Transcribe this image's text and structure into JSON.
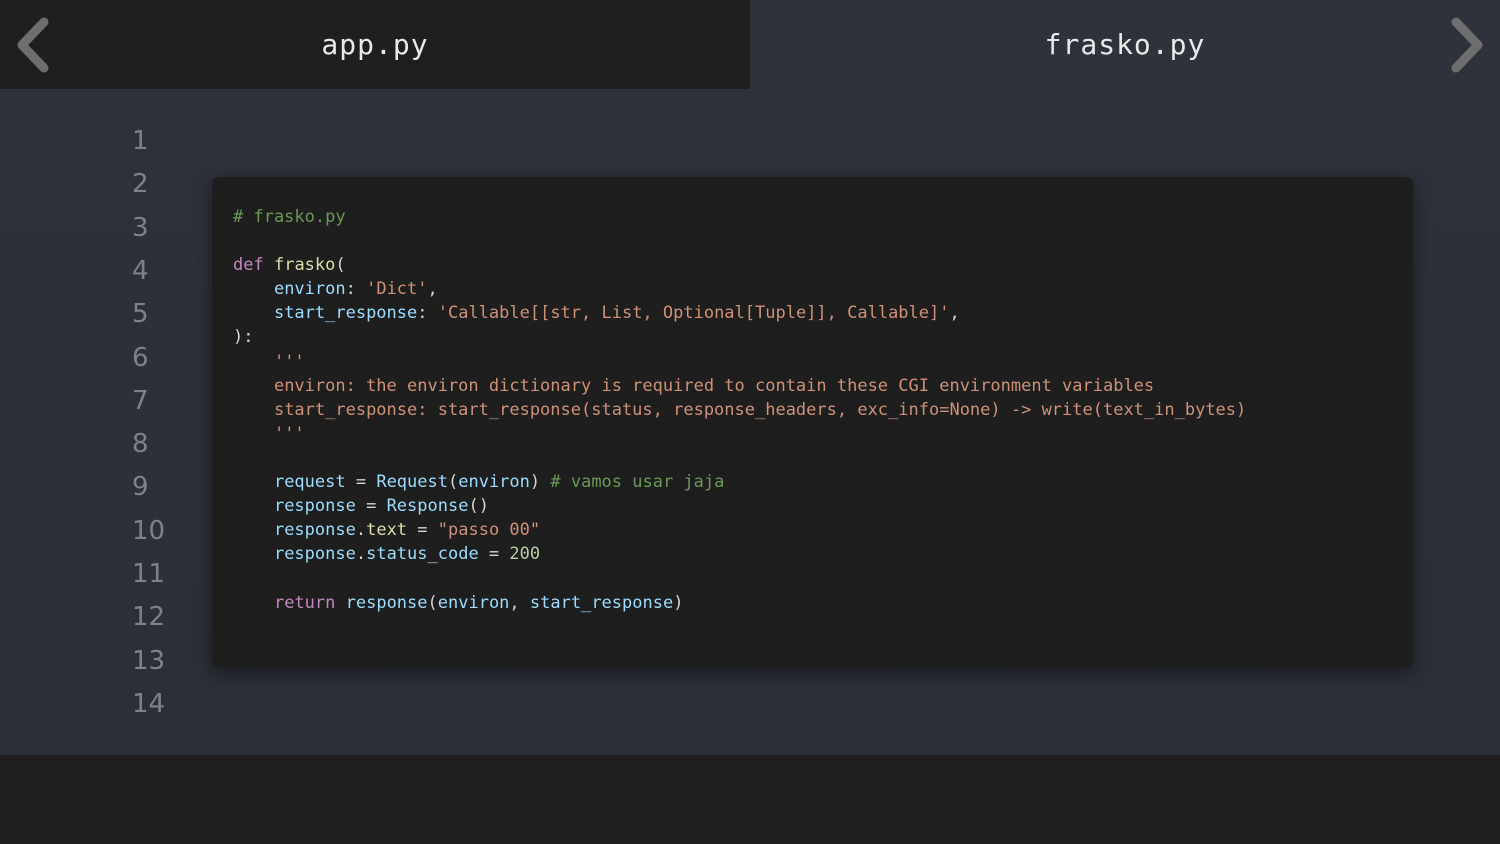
{
  "tabs": [
    {
      "label": "app.py",
      "active": false
    },
    {
      "label": "frasko.py",
      "active": true
    }
  ],
  "nav": {
    "prev_icon": "chevron-left-icon",
    "next_icon": "chevron-right-icon"
  },
  "line_numbers": [
    "1",
    "2",
    "3",
    "4",
    "5",
    "6",
    "7",
    "8",
    "9",
    "10",
    "11",
    "12",
    "13",
    "14"
  ],
  "code": {
    "comment_header": "# frasko.py",
    "def_kw": "def",
    "func_name": "frasko",
    "open_paren": "(",
    "param1": "environ",
    "param1_sep": ": ",
    "param1_type": "'Dict'",
    "comma": ",",
    "param2": "start_response",
    "param2_sep": ": ",
    "param2_type": "'Callable[[str, List, Optional[Tuple]], Callable]'",
    "close_sig": "):",
    "docstring_open": "'''",
    "doc_line1": "environ: the environ dictionary is required to contain these CGI environment variables",
    "doc_line2": "start_response: start_response(status, response_headers, exc_info=None) -> write(text_in_bytes)",
    "docstring_close": "'''",
    "req_var": "request",
    "req_eq": " = ",
    "req_call": "Request",
    "req_arg": "environ",
    "req_comment": "# vamos usar jaja",
    "resp_var": "response",
    "resp_eq": " = ",
    "resp_call": "Response",
    "resp_parens": "()",
    "text_obj": "response",
    "text_attr": "text",
    "text_eq": " = ",
    "text_val": "\"passo 00\"",
    "status_obj": "response",
    "status_attr": "status_code",
    "status_eq": " = ",
    "status_val": "200",
    "return_kw": "return",
    "return_call": "response",
    "return_arg1": "environ",
    "return_arg2": "start_response"
  },
  "colors": {
    "editor_bg": "#2d313a",
    "card_bg": "#1e1e1e",
    "comment": "#6a9955",
    "keyword": "#c586c0",
    "string": "#ce9178",
    "variable": "#9cdcfe",
    "function": "#dcdcaa",
    "number": "#b5cea8"
  }
}
